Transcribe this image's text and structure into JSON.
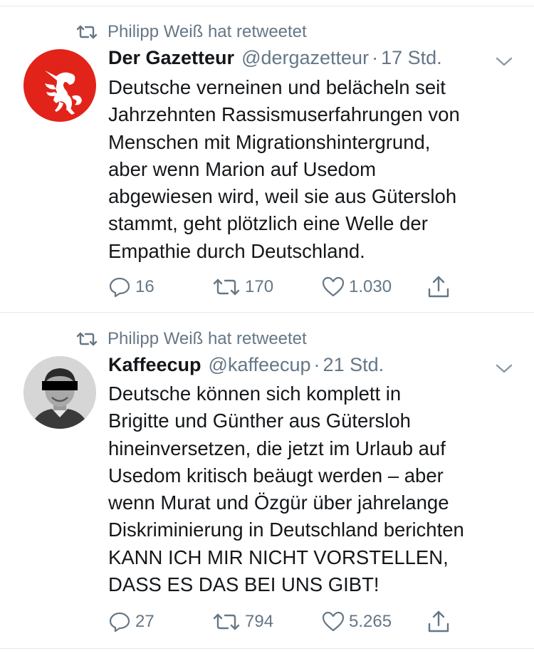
{
  "tweets": [
    {
      "retweet_label": "Philipp Weiß hat retweetet",
      "name": "Der Gazetteur",
      "handle": "@dergazetteur",
      "separator": "·",
      "time": "17 Std.",
      "avatar": "red-unicorn-logo",
      "text_lines": [
        "Deutsche verneinen und belächeln seit",
        "Jahrzehnten Rassismuserfahrungen von",
        "Menschen mit Migrationshintergrund,",
        "aber wenn Marion auf Usedom",
        "abgewiesen wird, weil sie aus Gütersloh",
        "stammt, geht plötzlich eine Welle der",
        "Empathie durch Deutschland."
      ],
      "replies": "16",
      "retweets": "170",
      "likes": "1.030"
    },
    {
      "retweet_label": "Philipp Weiß hat retweetet",
      "name": "Kaffeecup",
      "handle": "@kaffeecup",
      "separator": "·",
      "time": "21 Std.",
      "avatar": "user-photo-censored",
      "text_lines": [
        "Deutsche können sich komplett in",
        "Brigitte und Günther aus Gütersloh",
        "hineinversetzen, die jetzt im Urlaub auf",
        "Usedom kritisch beäugt werden – aber",
        "wenn Murat und Özgür über jahrelange",
        "Diskriminierung in Deutschland berichten",
        "KANN ICH MIR NICHT VORSTELLEN,",
        "DASS ES DAS BEI UNS GIBT!"
      ],
      "replies": "27",
      "retweets": "794",
      "likes": "5.265"
    }
  ],
  "icons": {
    "retweet": "retweet-icon",
    "reply": "reply-icon",
    "like": "heart-icon",
    "share": "share-icon",
    "caret": "chevron-down-icon"
  },
  "colors": {
    "text": "#14171a",
    "secondary": "#657786",
    "divider": "#e1e8ed",
    "gazetteur_red": "#e2231a"
  }
}
